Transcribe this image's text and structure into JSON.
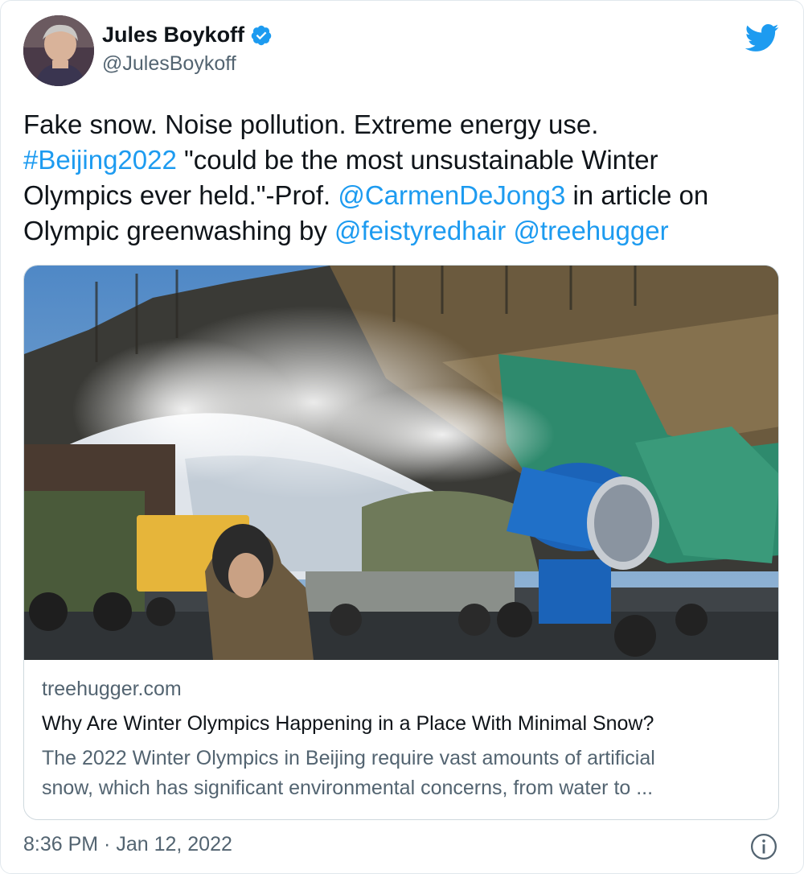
{
  "author": {
    "display_name": "Jules Boykoff",
    "handle": "@JulesBoykoff",
    "verified": true
  },
  "tweet": {
    "line1": "Fake snow. Noise pollution. Extreme energy use.",
    "hashtag": "#Beijing2022",
    "line2_rest": " \"could be the most unsustainable Winter",
    "line3_start": "Olympics ever held.\"-Prof. ",
    "mention1": "@CarmenDeJong3",
    "line3_end": " in article on",
    "line4_start": "Olympic greenwashing by ",
    "mention2": "@feistyredhair",
    "mention3": "@treehugger"
  },
  "card": {
    "domain": "treehugger.com",
    "title": "Why Are Winter Olympics Happening in a Place With Minimal Snow?",
    "description_line1": "The 2022 Winter Olympics in Beijing require vast amounts of artificial",
    "description_line2": "snow, which has significant environmental concerns, from water to ..."
  },
  "timestamp": "8:36 PM · Jan 12, 2022",
  "icons": {
    "brand": "twitter-bird-icon",
    "verified": "verified-badge-icon",
    "info": "info-icon"
  },
  "colors": {
    "link": "#1d9bf0",
    "secondary_text": "#536471",
    "primary_text": "#0f1419"
  }
}
